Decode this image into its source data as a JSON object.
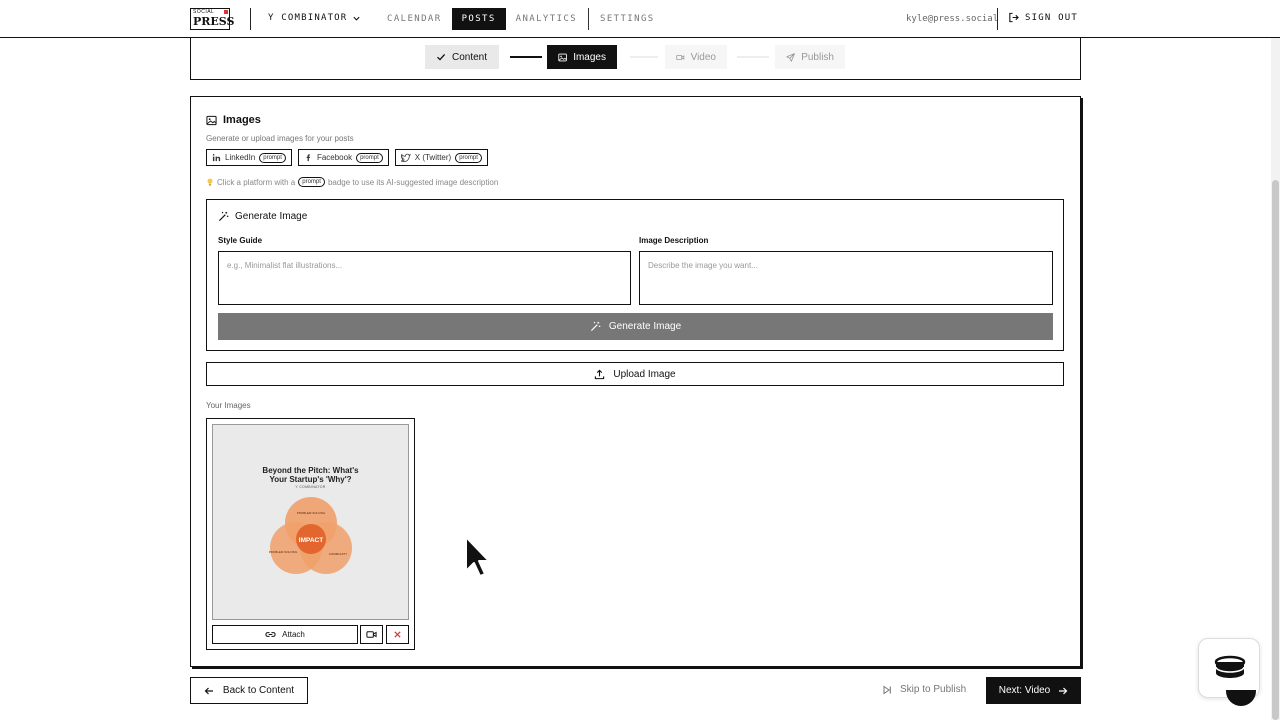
{
  "header": {
    "logo_top": "SOCIAL",
    "logo_main": "PRESS",
    "workspace": "Y COMBINATOR",
    "nav": [
      "CALENDAR",
      "POSTS",
      "ANALYTICS",
      "SETTINGS"
    ],
    "active_nav": "POSTS",
    "user_email": "kyle@press.social",
    "sign_out": "SIGN OUT"
  },
  "stepper": {
    "steps": [
      "Content",
      "Images",
      "Video",
      "Publish"
    ],
    "completed": [
      "Content"
    ],
    "active": "Images"
  },
  "images_section": {
    "title": "Images",
    "subtitle": "Generate or upload images for your posts",
    "platforms": [
      {
        "name": "LinkedIn",
        "badge": "prompt",
        "icon": "linkedin-icon"
      },
      {
        "name": "Facebook",
        "badge": "prompt",
        "icon": "facebook-icon"
      },
      {
        "name": "X (Twitter)",
        "badge": "prompt",
        "icon": "twitter-icon"
      }
    ],
    "hint_before": "Click a platform with a",
    "hint_badge": "prompt",
    "hint_after": "badge to use its AI-suggested image description"
  },
  "generate": {
    "title": "Generate Image",
    "style_label": "Style Guide",
    "style_placeholder": "e.g., Minimalist flat illustrations...",
    "desc_label": "Image Description",
    "desc_placeholder": "Describe the image you want...",
    "button": "Generate Image"
  },
  "upload": {
    "button": "Upload Image"
  },
  "your_images": {
    "label": "Your Images",
    "items": [
      {
        "title_line1": "Beyond the Pitch: What's",
        "title_line2": "Your Startup's 'Why'?",
        "caption": "Y COMBINATOR",
        "venn_center": "IMPACT",
        "venn_top": "PROBLEM SOLVING",
        "venn_left": "PROBLEM SOLVING",
        "venn_right": "COMMUNITY",
        "attach_label": "Attach"
      }
    ]
  },
  "footer": {
    "back": "Back to Content",
    "skip": "Skip to Publish",
    "next": "Next: Video"
  },
  "colors": {
    "ink": "#111111",
    "venn_orange": "#f0a06a",
    "venn_center": "#e2662e",
    "delete_red": "#d33333",
    "muted_button": "#777777"
  }
}
